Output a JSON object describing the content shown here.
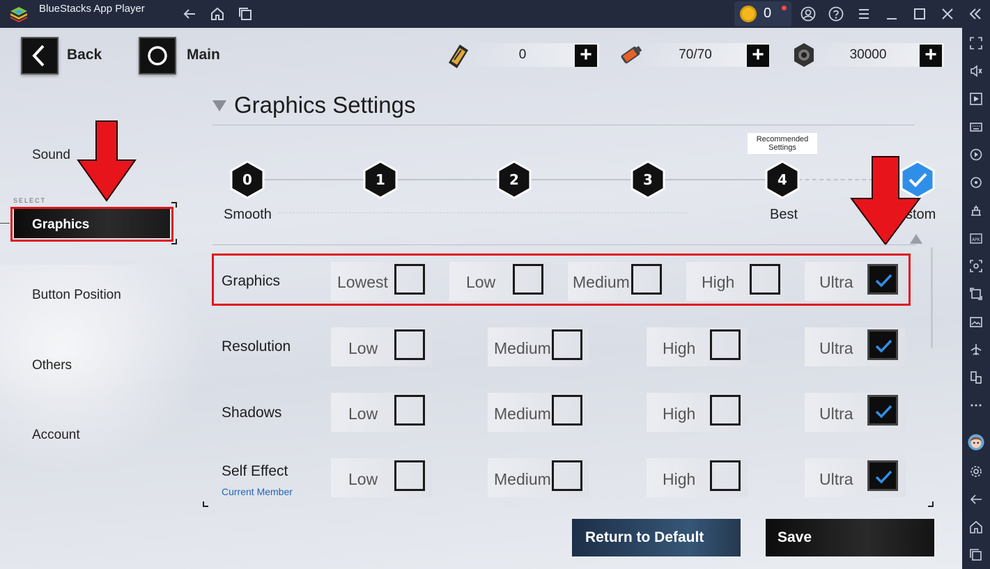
{
  "window": {
    "title": "BlueStacks App Player",
    "coin_count": "0"
  },
  "topbar": {
    "back_label": "Back",
    "main_label": "Main",
    "resources": [
      {
        "icon": "ticket-icon",
        "value": "0"
      },
      {
        "icon": "battery-icon",
        "value": "70/70"
      },
      {
        "icon": "tire-icon",
        "value": "30000"
      }
    ],
    "plus_label": "+"
  },
  "menu": {
    "select_caption": "SELECT",
    "items": [
      "Sound",
      "Graphics",
      "Button Position",
      "Others",
      "Account"
    ],
    "selected": "Graphics"
  },
  "graphics": {
    "heading": "Graphics Settings",
    "recommended_badge": "Recommended Settings",
    "presets": [
      {
        "num": "0",
        "label": "Smooth"
      },
      {
        "num": "1",
        "label": ""
      },
      {
        "num": "2",
        "label": ""
      },
      {
        "num": "3",
        "label": ""
      },
      {
        "num": "4",
        "label": "Best"
      },
      {
        "num": "",
        "label": "Custom",
        "visible_label": "stom"
      }
    ],
    "rows": [
      {
        "label": "Graphics",
        "options": [
          "Lowest",
          "Low",
          "Medium",
          "High",
          "Ultra"
        ],
        "checked": "Ultra"
      },
      {
        "label": "Resolution",
        "options": [
          "Low",
          "Medium",
          "High",
          "Ultra"
        ],
        "checked": "Ultra"
      },
      {
        "label": "Shadows",
        "options": [
          "Low",
          "Medium",
          "High",
          "Ultra"
        ],
        "checked": "Ultra"
      },
      {
        "label": "Self Effect",
        "sublabel": "Current Member",
        "options": [
          "Low",
          "Medium",
          "High",
          "Ultra"
        ],
        "checked": "Ultra"
      }
    ]
  },
  "buttons": {
    "return_default": "Return to Default",
    "save": "Save"
  },
  "colors": {
    "highlight_red": "#e0151c",
    "check_blue": "#2f8fe8"
  }
}
